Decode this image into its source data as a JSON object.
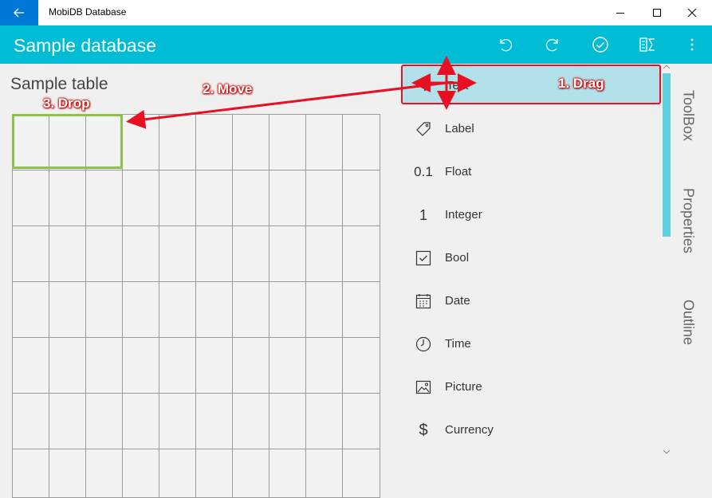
{
  "window": {
    "title": "MobiDB Database"
  },
  "appbar": {
    "title": "Sample database"
  },
  "canvas": {
    "table_title": "Sample table"
  },
  "toolbox": {
    "items": [
      {
        "icon_text": "T",
        "label": "Text",
        "icon": "text-icon"
      },
      {
        "icon_text": "",
        "label": "Label",
        "icon": "label-tag-icon"
      },
      {
        "icon_text": "0.1",
        "label": "Float",
        "icon": "float-icon"
      },
      {
        "icon_text": "1",
        "label": "Integer",
        "icon": "integer-icon"
      },
      {
        "icon_text": "",
        "label": "Bool",
        "icon": "checkbox-icon"
      },
      {
        "icon_text": "",
        "label": "Date",
        "icon": "calendar-icon"
      },
      {
        "icon_text": "",
        "label": "Time",
        "icon": "clock-icon"
      },
      {
        "icon_text": "",
        "label": "Picture",
        "icon": "picture-icon"
      },
      {
        "icon_text": "$",
        "label": "Currency",
        "icon": "currency-icon"
      }
    ]
  },
  "side_tabs": {
    "toolbox": "ToolBox",
    "properties": "Properties",
    "outline": "Outline"
  },
  "annotations": {
    "drag": "1. Drag",
    "move": "2. Move",
    "drop": "3. Drop"
  },
  "colors": {
    "accent": "#00bcd4",
    "title_back_button": "#0078d7",
    "selection": "#b2e1e9",
    "annotation_red": "#e81123",
    "drop_highlight": "#8bc34a"
  }
}
